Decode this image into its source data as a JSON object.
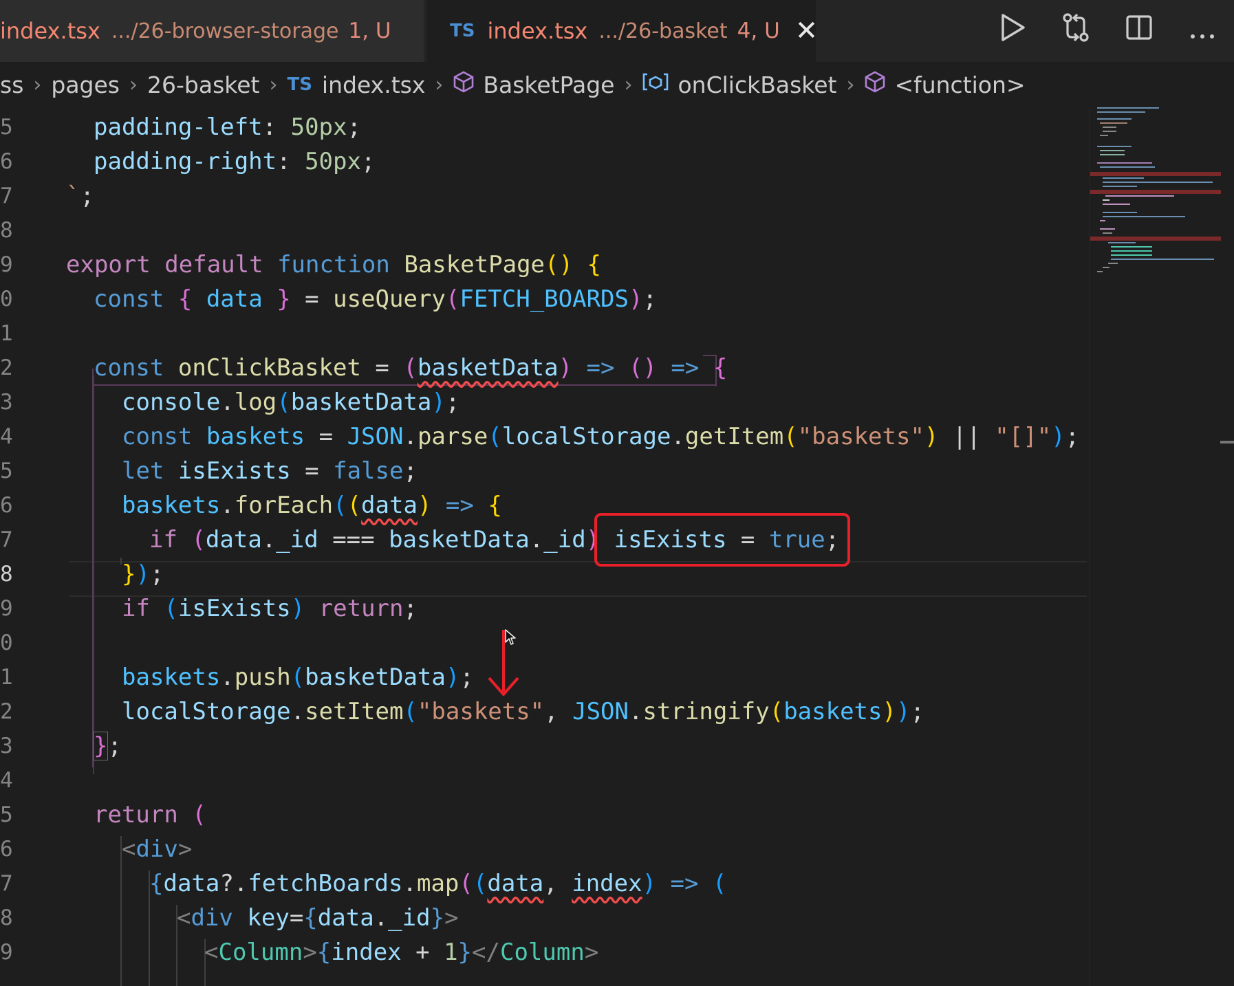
{
  "tabs": [
    {
      "icon": "",
      "name": "index.tsx",
      "path": ".../26-browser-storage",
      "status": "1, U"
    },
    {
      "icon": "TS",
      "name": "index.tsx",
      "path": ".../26-basket",
      "status": "4, U",
      "close": "✕"
    }
  ],
  "breadcrumbs": {
    "items": [
      "ss",
      "pages",
      "26-basket",
      "index.tsx",
      "BasketPage",
      "onClickBasket",
      "<function>"
    ],
    "ts_icon": "TS"
  },
  "editor": {
    "line_numbers": [
      "5",
      "6",
      "7",
      "8",
      "9",
      "0",
      "1",
      "2",
      "3",
      "4",
      "5",
      "6",
      "7",
      "8",
      "9",
      "0",
      "1",
      "2",
      "3",
      "4",
      "5",
      "6",
      "7",
      "8",
      "9"
    ],
    "current_line_index": 13,
    "lines": [
      "padding-left: 50px;",
      "padding-right: 50px;",
      "`;",
      "",
      "export default function BasketPage() {",
      "const { data } = useQuery(FETCH_BOARDS);",
      "",
      "const onClickBasket = (basketData) => () => {",
      "console.log(basketData);",
      "const baskets = JSON.parse(localStorage.getItem(\"baskets\") || \"[]\");",
      "let isExists = false;",
      "baskets.forEach((data) => {",
      "if (data._id === basketData._id) isExists = true;",
      "});",
      "if (isExists) return;",
      "",
      "baskets.push(basketData);",
      "localStorage.setItem(\"baskets\", JSON.stringify(baskets));",
      "};",
      "",
      "return (",
      "<div>",
      "{data?.fetchBoards.map((data, index) => (",
      "<div key={data._id}>",
      "<Column>{index + 1}</Column>"
    ]
  },
  "colors": {
    "highlight_box": "#e8202a",
    "annotation_arrow": "#e8202a",
    "keyword": "#c586c0",
    "storage": "#569cd6",
    "function": "#dcdcaa",
    "variable": "#9cdcfe",
    "string": "#ce9178"
  },
  "icons": [
    "run-icon",
    "source-control-compare-icon",
    "split-editor-icon",
    "more-actions-icon",
    "close-icon",
    "symbol-method-icon",
    "symbol-variable-icon"
  ]
}
